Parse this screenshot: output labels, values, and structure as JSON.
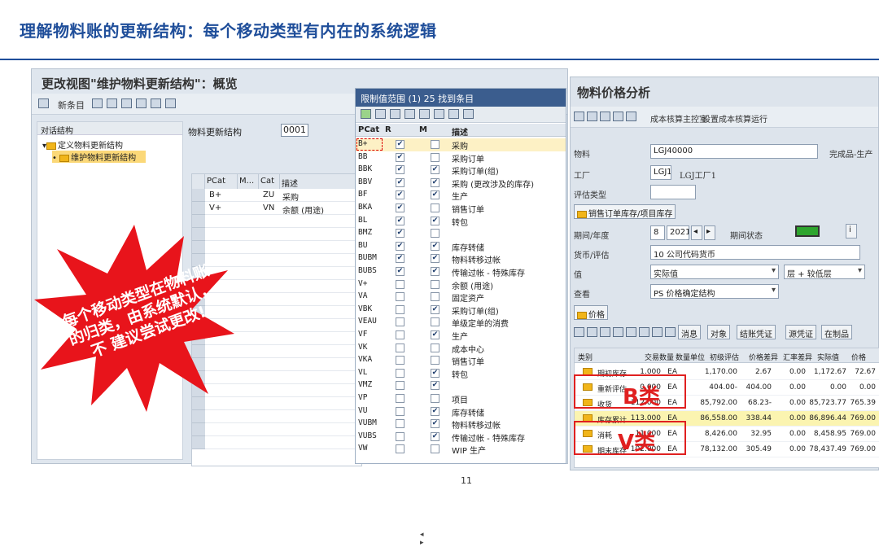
{
  "slide": {
    "title": "理解物料账的更新结构：每个移动类型有内在的系统逻辑",
    "page_number": "11"
  },
  "left_window": {
    "title": "更改视图\"维护物料更新结构\"：概览",
    "toolbar_new_entry": "新条目",
    "tree_header": "对话结构",
    "tree_items": [
      "定义物料更新结构",
      "维护物料更新结构"
    ],
    "field_label": "物料更新结构",
    "field_value": "0001",
    "table_headers": [
      "PCat",
      "M...",
      "Cat",
      "描述"
    ],
    "table_rows": [
      {
        "pcat": "B+",
        "cat": "ZU",
        "desc": "采购"
      },
      {
        "pcat": "V+",
        "cat": "VN",
        "desc": "余额 (用途)"
      }
    ]
  },
  "burst_text": "每个移动类型在物料账的归类，由系统默认，不 建议尝试更改!",
  "middle_window": {
    "title": "限制值范围 (1)   25 找到条目",
    "headers": [
      "PCat",
      "R",
      "M",
      "描述"
    ],
    "rows": [
      {
        "pcat": "B+",
        "r": true,
        "m": false,
        "desc": "采购"
      },
      {
        "pcat": "BB",
        "r": true,
        "m": false,
        "desc": "采购订单"
      },
      {
        "pcat": "BBK",
        "r": true,
        "m": true,
        "desc": "采购订单(组)"
      },
      {
        "pcat": "BBV",
        "r": true,
        "m": true,
        "desc": "采购 (更改涉及的库存)"
      },
      {
        "pcat": "BF",
        "r": true,
        "m": true,
        "desc": "生产"
      },
      {
        "pcat": "BKA",
        "r": true,
        "m": false,
        "desc": "销售订单"
      },
      {
        "pcat": "BL",
        "r": true,
        "m": true,
        "desc": "转包"
      },
      {
        "pcat": "BMZ",
        "r": true,
        "m": false,
        "desc": ""
      },
      {
        "pcat": "BU",
        "r": true,
        "m": true,
        "desc": "库存转储"
      },
      {
        "pcat": "BUBM",
        "r": true,
        "m": true,
        "desc": "物料转移过帐"
      },
      {
        "pcat": "BUBS",
        "r": true,
        "m": true,
        "desc": "传输过帐 - 特殊库存"
      },
      {
        "pcat": "V+",
        "r": false,
        "m": false,
        "desc": "余额 (用途)"
      },
      {
        "pcat": "VA",
        "r": false,
        "m": false,
        "desc": "固定资产"
      },
      {
        "pcat": "VBK",
        "r": false,
        "m": true,
        "desc": "采购订单(组)"
      },
      {
        "pcat": "VEAU",
        "r": false,
        "m": false,
        "desc": "单级定单的消费"
      },
      {
        "pcat": "VF",
        "r": false,
        "m": true,
        "desc": "生产"
      },
      {
        "pcat": "VK",
        "r": false,
        "m": false,
        "desc": "成本中心"
      },
      {
        "pcat": "VKA",
        "r": false,
        "m": false,
        "desc": "销售订单"
      },
      {
        "pcat": "VL",
        "r": false,
        "m": true,
        "desc": "转包"
      },
      {
        "pcat": "VMZ",
        "r": false,
        "m": true,
        "desc": ""
      },
      {
        "pcat": "VP",
        "r": false,
        "m": false,
        "desc": "项目"
      },
      {
        "pcat": "VU",
        "r": false,
        "m": true,
        "desc": "库存转储"
      },
      {
        "pcat": "VUBM",
        "r": false,
        "m": true,
        "desc": "物料转移过帐"
      },
      {
        "pcat": "VUBS",
        "r": false,
        "m": true,
        "desc": "传输过帐 - 特殊库存"
      },
      {
        "pcat": "VW",
        "r": false,
        "m": false,
        "desc": "WIP 生产"
      }
    ]
  },
  "right_window": {
    "title": "物料价格分析",
    "toolbar_links": [
      "成本核算主控室",
      "设置成本核算运行"
    ],
    "material_label": "物料",
    "material_value": "LGJ40000",
    "material_type": "完成品-生产",
    "plant_label": "工厂",
    "plant_value": "LGJ1",
    "plant_name": "LGJ工厂1",
    "valtype_label": "评估类型",
    "tab_label": "销售订单库存/项目库存",
    "period_label": "期间/年度",
    "period_value": "8",
    "year_value": "2021",
    "period_status_label": "期间状态",
    "currency_label": "货币/评估",
    "currency_value": "10 公司代码货币",
    "value_label": "值",
    "value_value": "实际值",
    "layer_value": "层 + 较低层",
    "view_label": "查看",
    "view_value": "PS 价格确定结构",
    "price_label": "价格",
    "buttons": [
      "消息",
      "对象",
      "结账凭证",
      "源凭证",
      "在制品"
    ],
    "table_headers": [
      "类别",
      "交易数量",
      "数量单位",
      "初级评估",
      "价格差异",
      "汇率差异",
      "实际值",
      "价格"
    ],
    "rows": [
      {
        "cat": "期初库存",
        "qty": "1.000",
        "unit": "EA",
        "prelim": "1,170.00",
        "pdiff": "2.67",
        "xdiff": "0.00",
        "actual": "1,172.67",
        "price": "72.67"
      },
      {
        "cat": "重新评估",
        "qty": "0.000",
        "unit": "EA",
        "prelim": "404.00-",
        "pdiff": "404.00",
        "xdiff": "0.00",
        "actual": "0.00",
        "price": "0.00"
      },
      {
        "cat": "收货",
        "qty": "112.000",
        "unit": "EA",
        "prelim": "85,792.00",
        "pdiff": "68.23-",
        "xdiff": "0.00",
        "actual": "85,723.77",
        "price": "765.39"
      },
      {
        "cat": "库存累计",
        "qty": "113.000",
        "unit": "EA",
        "prelim": "86,558.00",
        "pdiff": "338.44",
        "xdiff": "0.00",
        "actual": "86,896.44",
        "price": "769.00"
      },
      {
        "cat": "消耗",
        "qty": "11.000",
        "unit": "EA",
        "prelim": "8,426.00",
        "pdiff": "32.95",
        "xdiff": "0.00",
        "actual": "8,458.95",
        "price": "769.00"
      },
      {
        "cat": "期末库存",
        "qty": "102.000",
        "unit": "EA",
        "prelim": "78,132.00",
        "pdiff": "305.49",
        "xdiff": "0.00",
        "actual": "78,437.49",
        "price": "769.00"
      }
    ],
    "annot_b": "B类",
    "annot_v": "V类"
  }
}
